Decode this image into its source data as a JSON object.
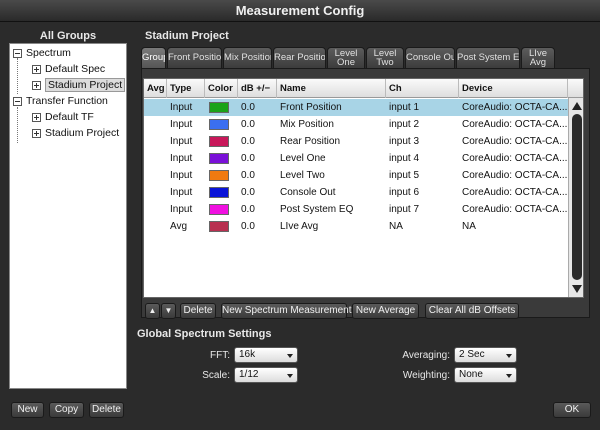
{
  "window": {
    "title": "Measurement Config"
  },
  "groups": {
    "title": "All Groups",
    "tree": [
      {
        "label": "Spectrum",
        "level": 0,
        "expander": "minus"
      },
      {
        "label": "Default Spec",
        "level": 1,
        "expander": "plus"
      },
      {
        "label": "Stadium Project",
        "level": 1,
        "expander": "plus",
        "selected": true
      },
      {
        "label": "Transfer Function",
        "level": 0,
        "expander": "minus"
      },
      {
        "label": "Default TF",
        "level": 1,
        "expander": "plus"
      },
      {
        "label": "Stadium Project",
        "level": 1,
        "expander": "plus"
      }
    ],
    "buttons": {
      "new": "New",
      "copy": "Copy",
      "delete": "Delete"
    }
  },
  "project": {
    "title": "Stadium Project",
    "tabs": [
      {
        "line1": "Group",
        "line2": "",
        "active": true
      },
      {
        "line1": "Front Position",
        "line2": ""
      },
      {
        "line1": "Mix Position",
        "line2": ""
      },
      {
        "line1": "Rear Position",
        "line2": ""
      },
      {
        "line1": "Level",
        "line2": "One"
      },
      {
        "line1": "Level",
        "line2": "Two"
      },
      {
        "line1": "Console Out",
        "line2": ""
      },
      {
        "line1": "Post System EQ",
        "line2": ""
      },
      {
        "line1": "LIve",
        "line2": "Avg"
      }
    ],
    "columns": [
      "Avg",
      "Type",
      "Color",
      "dB +/−",
      "Name",
      "Ch",
      "Device"
    ],
    "rows": [
      {
        "avg": "",
        "type": "Input",
        "color": "#1aa318",
        "db": "0.0",
        "name": "Front Position",
        "ch": "input 1",
        "device": "CoreAudio: OCTA-CA...",
        "selected": true
      },
      {
        "avg": "",
        "type": "Input",
        "color": "#3b6ff0",
        "db": "0.0",
        "name": "Mix Position",
        "ch": "input 2",
        "device": "CoreAudio: OCTA-CA..."
      },
      {
        "avg": "",
        "type": "Input",
        "color": "#c8185a",
        "db": "0.0",
        "name": "Rear Position",
        "ch": "input 3",
        "device": "CoreAudio: OCTA-CA..."
      },
      {
        "avg": "",
        "type": "Input",
        "color": "#7a10d8",
        "db": "0.0",
        "name": "Level One",
        "ch": "input 4",
        "device": "CoreAudio: OCTA-CA..."
      },
      {
        "avg": "",
        "type": "Input",
        "color": "#f07a10",
        "db": "0.0",
        "name": "Level Two",
        "ch": "input 5",
        "device": "CoreAudio: OCTA-CA..."
      },
      {
        "avg": "",
        "type": "Input",
        "color": "#0a14d8",
        "db": "0.0",
        "name": "Console Out",
        "ch": "input 6",
        "device": "CoreAudio: OCTA-CA..."
      },
      {
        "avg": "",
        "type": "Input",
        "color": "#f010e0",
        "db": "0.0",
        "name": "Post System EQ",
        "ch": "input 7",
        "device": "CoreAudio: OCTA-CA..."
      },
      {
        "avg": "",
        "type": "Avg",
        "color": "#b83050",
        "db": "0.0",
        "name": "LIve Avg",
        "ch": "NA",
        "device": "NA"
      }
    ],
    "toolbar": {
      "up": "▲",
      "down": "▼",
      "delete": "Delete",
      "new_spectrum": "New Spectrum Measurement",
      "new_average": "New Average",
      "clear_offsets": "Clear All dB Offsets"
    }
  },
  "global_settings": {
    "title": "Global Spectrum Settings",
    "fft": {
      "label": "FFT:",
      "value": "16k"
    },
    "scale": {
      "label": "Scale:",
      "value": "1/12"
    },
    "averaging": {
      "label": "Averaging:",
      "value": "2 Sec"
    },
    "weighting": {
      "label": "Weighting:",
      "value": "None"
    }
  },
  "footer": {
    "ok": "OK"
  }
}
